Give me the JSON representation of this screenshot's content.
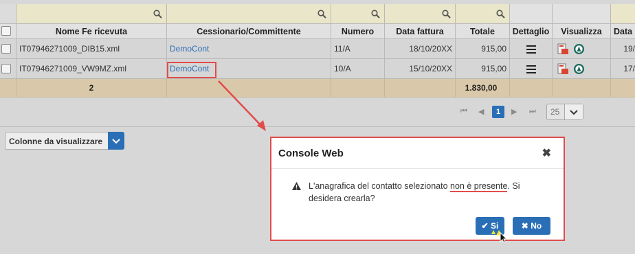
{
  "table": {
    "columns": [
      "Nome Fe ricevuta",
      "Cessionario/Committente",
      "Numero",
      "Data fattura",
      "Totale",
      "Dettaglio",
      "Visualizza",
      "Data"
    ],
    "rows": [
      {
        "nome": "IT07946271009_DIB15.xml",
        "cessionario": "DemoCont",
        "numero": "11/A",
        "data": "18/10/20XX",
        "totale": "915,00",
        "data2": "19/"
      },
      {
        "nome": "IT07946271009_VW9MZ.xml",
        "cessionario": "DemoCont",
        "numero": "10/A",
        "data": "15/10/20XX",
        "totale": "915,00",
        "data2": "17/"
      }
    ],
    "totals": {
      "count": "2",
      "totale": "1.830,00"
    }
  },
  "pager": {
    "current": "1",
    "page_size": "25"
  },
  "columns_selector": {
    "label": "Colonne da visualizzare"
  },
  "modal": {
    "title": "Console Web",
    "message_before": "L'anagrafica del contatto selezionato ",
    "message_highlight": "non è presente",
    "message_after": ". Si desidera crearla?",
    "yes_label": "Si",
    "no_label": "No"
  },
  "colors": {
    "accent": "#2a6fb6",
    "highlight": "#e24b4b",
    "total_row": "#d9c9aa"
  }
}
